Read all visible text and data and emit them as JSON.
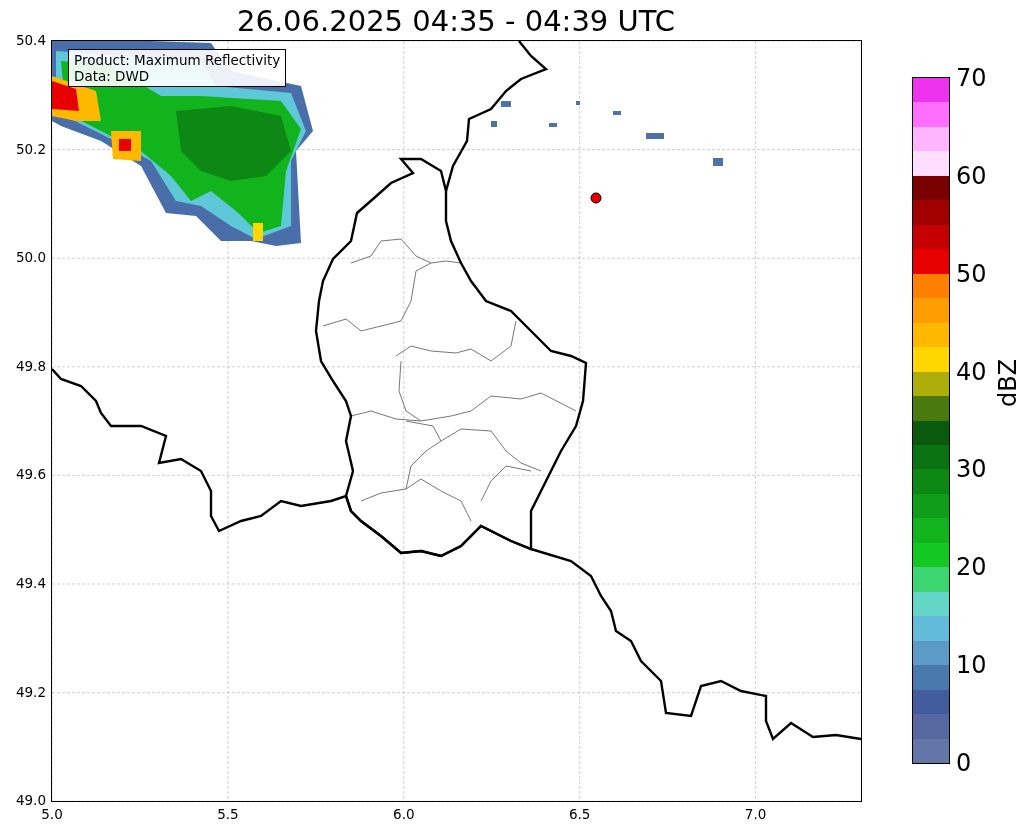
{
  "title": "26.06.2025 04:35 - 04:39 UTC",
  "legend": [
    "Product: Maximum Reflectivity",
    "Data: DWD"
  ],
  "xticks": [
    "5.0",
    "5.5",
    "6.0",
    "6.5",
    "7.0"
  ],
  "yticks": [
    "50.4",
    "50.2",
    "50.0",
    "49.8",
    "49.6",
    "49.4",
    "49.2",
    "49.0"
  ],
  "colorbar": {
    "label": "dBZ",
    "ticks": [
      "70",
      "60",
      "50",
      "40",
      "30",
      "20",
      "10",
      "0"
    ],
    "segments": [
      {
        "color": "#6475a8"
      },
      {
        "color": "#5768a0"
      },
      {
        "color": "#435c9e"
      },
      {
        "color": "#4a79ae"
      },
      {
        "color": "#5b9bc6"
      },
      {
        "color": "#62bcd9"
      },
      {
        "color": "#63d6c7"
      },
      {
        "color": "#3dd472"
      },
      {
        "color": "#14c824"
      },
      {
        "color": "#12b41e"
      },
      {
        "color": "#109e18"
      },
      {
        "color": "#0e8814"
      },
      {
        "color": "#0b7212"
      },
      {
        "color": "#0a5a0e"
      },
      {
        "color": "#4a7a0e"
      },
      {
        "color": "#aeae0a"
      },
      {
        "color": "#ffd700"
      },
      {
        "color": "#ffb800"
      },
      {
        "color": "#ff9e00"
      },
      {
        "color": "#ff8000"
      },
      {
        "color": "#e60000"
      },
      {
        "color": "#c40000"
      },
      {
        "color": "#a00000"
      },
      {
        "color": "#7a0000"
      },
      {
        "color": "#ffddff"
      },
      {
        "color": "#ffb4ff"
      },
      {
        "color": "#ff6eff"
      },
      {
        "color": "#ee33ee"
      }
    ]
  }
}
